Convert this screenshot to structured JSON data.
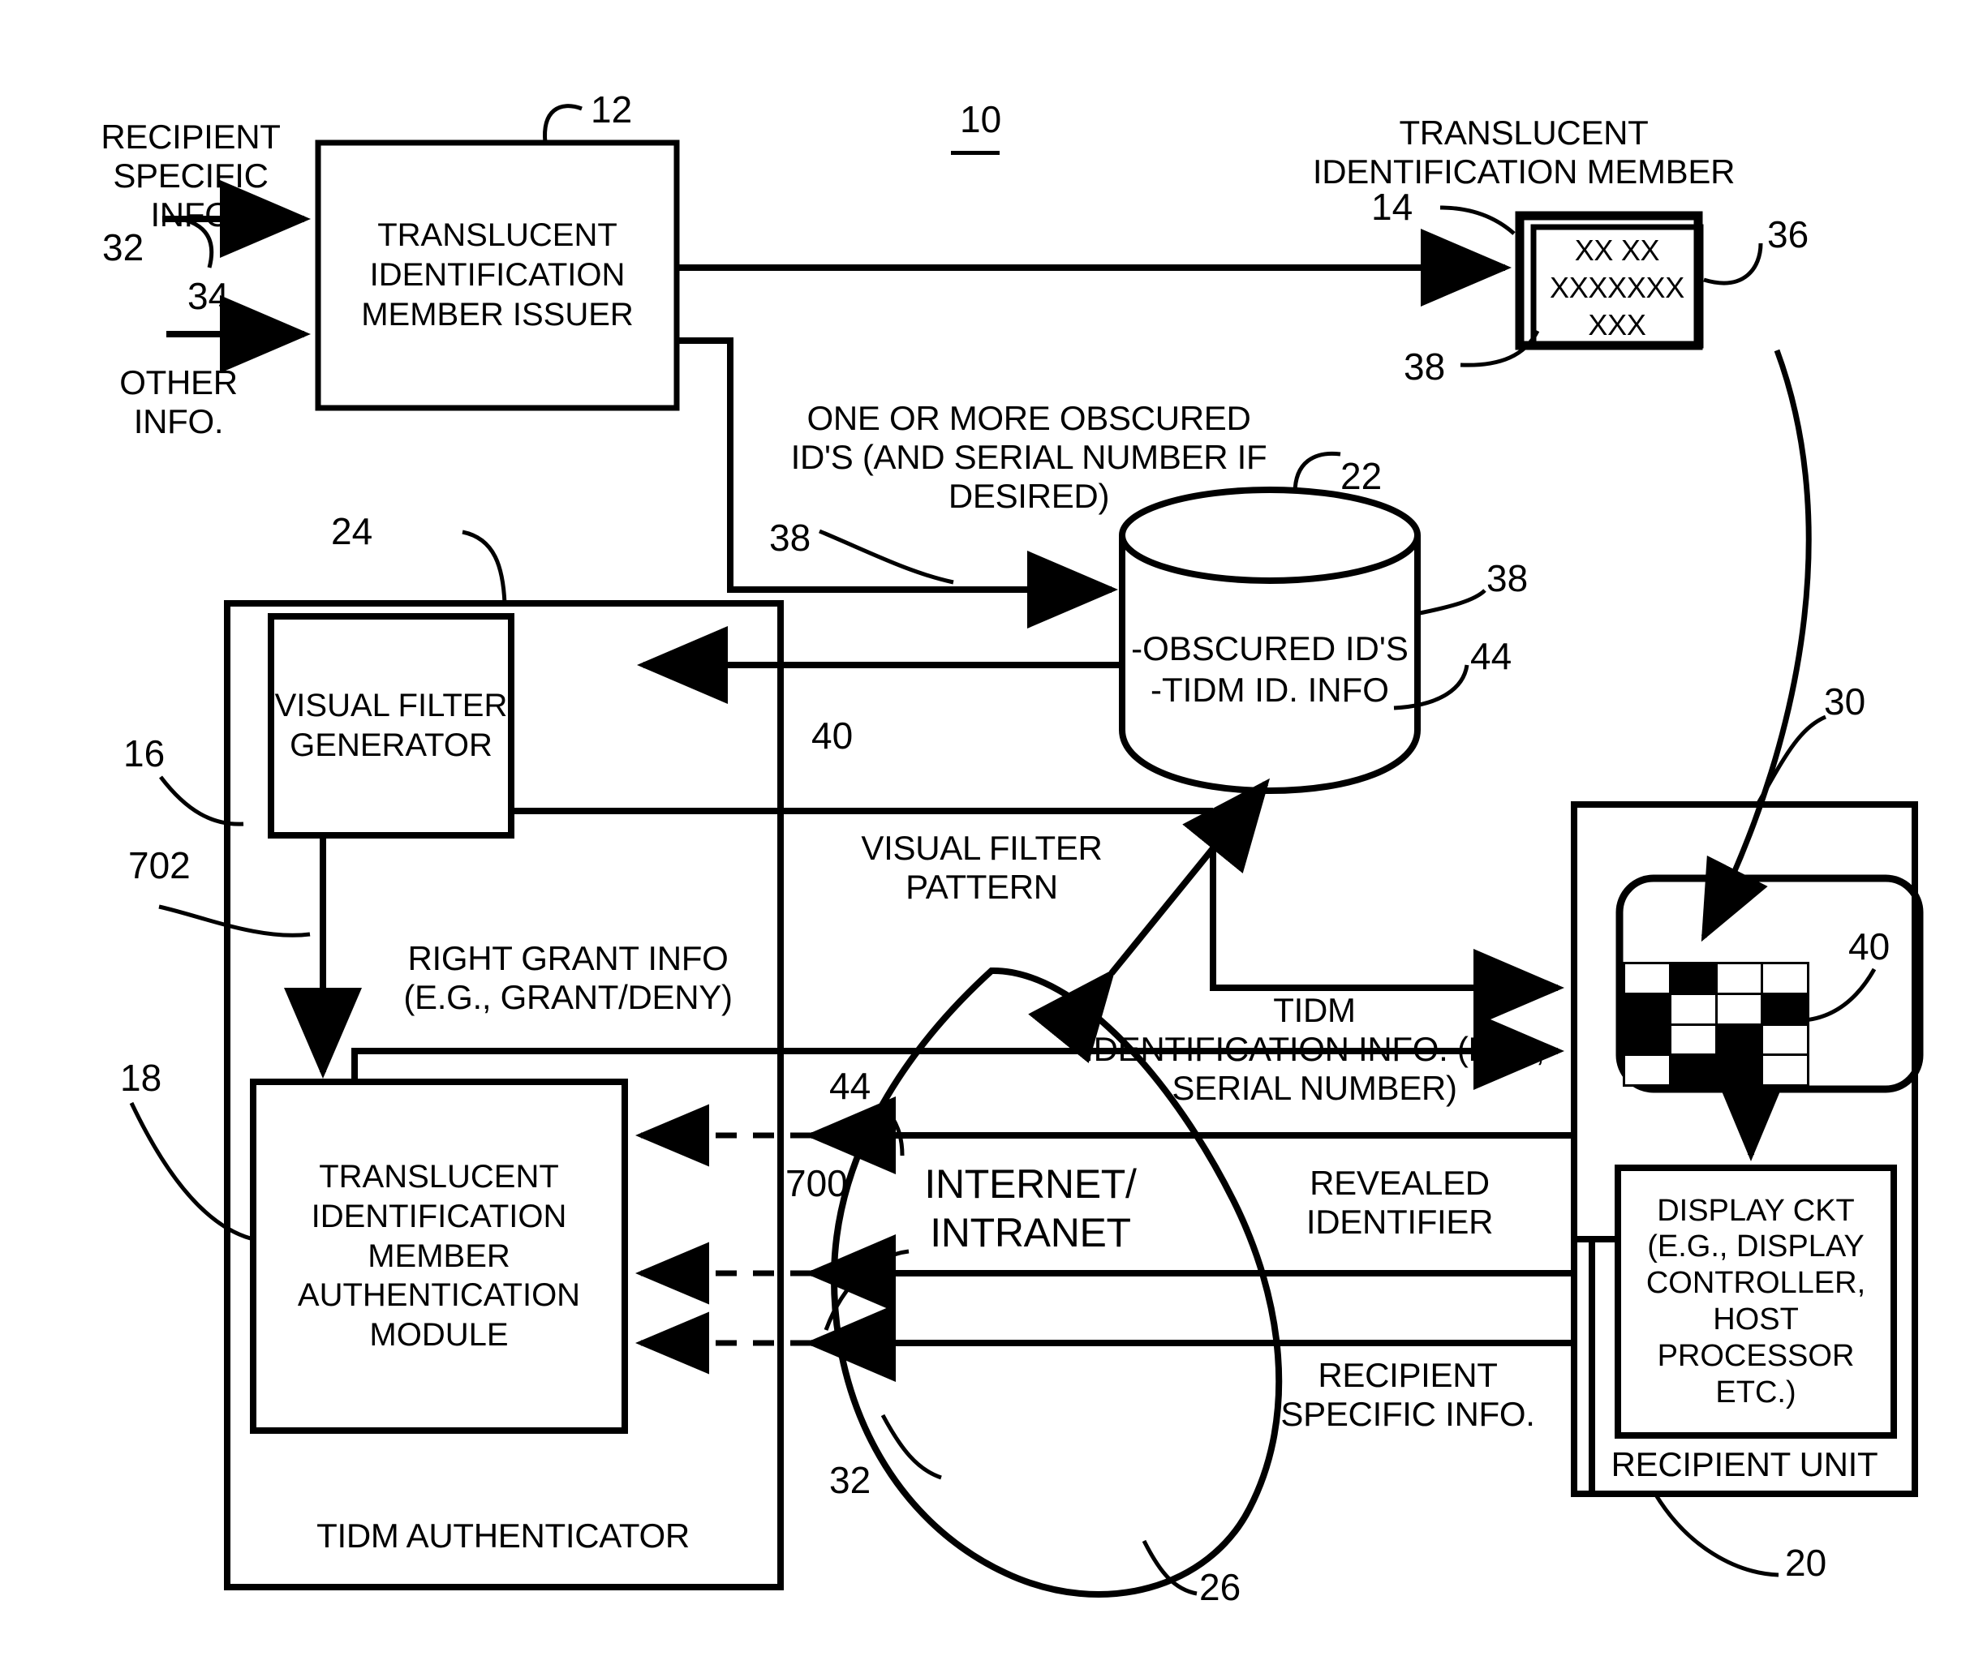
{
  "figure": {
    "number": "10"
  },
  "blocks": {
    "tidm_issuer": {
      "label": "TRANSLUCENT\nIDENTIFICATION\nMEMBER ISSUER",
      "ref": "12"
    },
    "tidm_member": {
      "heading": "TRANSLUCENT\nIDENTIFICATION MEMBER",
      "ref": "14",
      "card_ref": "36",
      "obscured_ref": "38",
      "card_lines": [
        "XX XX",
        "XXXXXXX",
        "XXX"
      ]
    },
    "database": {
      "label": "-OBSCURED ID'S\n-TIDM ID. INFO",
      "ref": "22",
      "obscured_ref": "38",
      "tidm_info_ref": "44"
    },
    "visual_filter_generator": {
      "label": "VISUAL FILTER\nGENERATOR",
      "ref": "16"
    },
    "tidm_authenticator": {
      "label": "TIDM AUTHENTICATOR",
      "ref": "24"
    },
    "tidm_auth_module": {
      "label": "TRANSLUCENT\nIDENTIFICATION\nMEMBER\nAUTHENTICATION\nMODULE",
      "ref": "18",
      "grant_ref": "702"
    },
    "internet": {
      "label": "INTERNET/\nINTRANET",
      "ref": "26",
      "ref_700": "700",
      "ref_44": "44",
      "ref_32": "32"
    },
    "recipient_unit": {
      "label": "RECIPIENT UNIT",
      "ref": "30",
      "unit_ref": "20",
      "pattern_ref": "40",
      "display_ckt": "DISPLAY CKT\n(E.G., DISPLAY\nCONTROLLER,\nHOST\nPROCESSOR\nETC.)"
    }
  },
  "flow_labels": {
    "recipient_specific_info_in": "RECIPIENT\nSPECIFIC INFO",
    "recipient_specific_info_in_ref": "32",
    "other_info_in": "OTHER\nINFO.",
    "other_info_in_ref": "34",
    "obscured_ids": "ONE OR MORE OBSCURED\nID'S (AND SERIAL NUMBER IF\nDESIRED)",
    "obscured_ids_ref": "38",
    "visual_filter_pattern": "VISUAL FILTER\nPATTERN",
    "visual_filter_pattern_ref": "40",
    "right_grant_info": "RIGHT GRANT INFO\n(E.G., GRANT/DENY)",
    "tidm_identification_info": "TIDM\nIDENTIFICATION INFO. (E.G.,\nSERIAL NUMBER)",
    "revealed_identifier": "REVEALED\nIDENTIFIER",
    "recipient_specific_info_out": "RECIPIENT\nSPECIFIC INFO."
  },
  "filter_pattern": {
    "columns": 4,
    "rows": 4,
    "cells": [
      [
        "w",
        "b",
        "w",
        "w"
      ],
      [
        "b",
        "w",
        "w",
        "b"
      ],
      [
        "b",
        "w",
        "b",
        "w"
      ],
      [
        "w",
        "b",
        "b",
        "w"
      ]
    ]
  },
  "colors": {
    "ink": "#000000",
    "paper": "#ffffff"
  }
}
